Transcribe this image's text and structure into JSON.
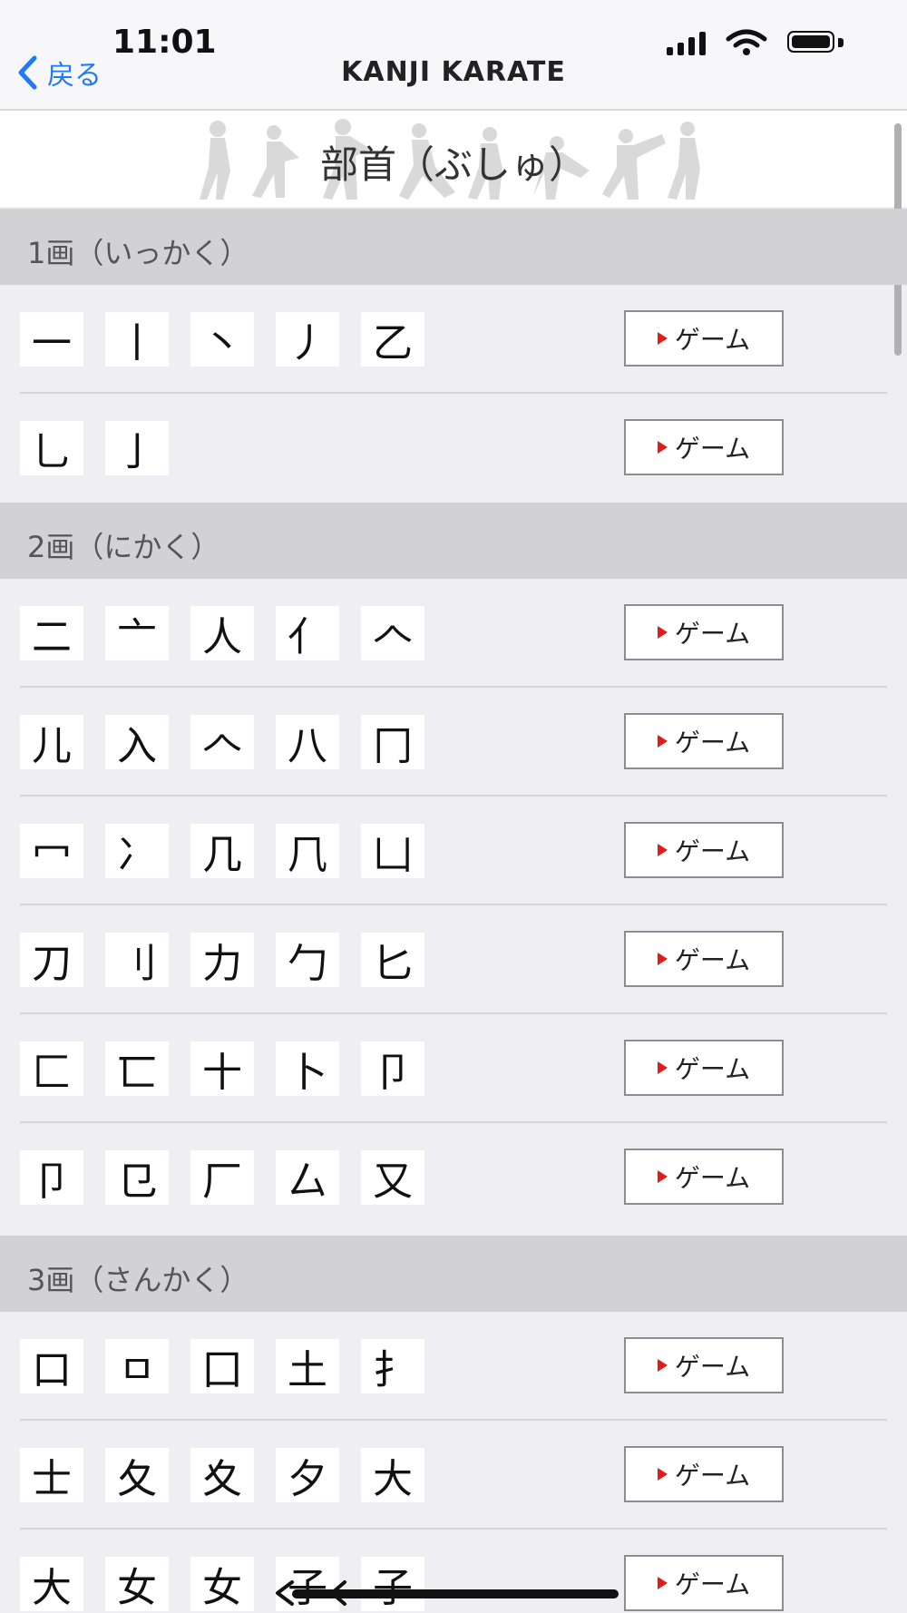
{
  "status_bar": {
    "time": "11:01",
    "icons": [
      "cellular-signal-icon",
      "wifi-icon",
      "battery-icon"
    ]
  },
  "nav": {
    "back_label": "戻る",
    "title": "KANJI KARATE"
  },
  "banner": {
    "title": "部首（ぶしゅ）"
  },
  "colors": {
    "accent": "#1f7af5",
    "play_icon": "#e21b1b",
    "section_header_bg": "#d2d2d5",
    "page_bg": "#efeef3"
  },
  "sections": [
    {
      "header": "1画（いっかく）",
      "rows": [
        {
          "chars": [
            "一",
            "丨",
            "丶",
            "丿",
            "乙"
          ],
          "button": "ゲーム"
        },
        {
          "chars": [
            "乚",
            "亅"
          ],
          "button": "ゲーム"
        }
      ]
    },
    {
      "header": "2画（にかく）",
      "rows": [
        {
          "chars": [
            "二",
            "亠",
            "人",
            "亻",
            "𠆢"
          ],
          "button": "ゲーム"
        },
        {
          "chars": [
            "儿",
            "入",
            "𠆢",
            "八",
            "冂"
          ],
          "button": "ゲーム"
        },
        {
          "chars": [
            "冖",
            "冫",
            "几",
            "⺇",
            "凵"
          ],
          "button": "ゲーム"
        },
        {
          "chars": [
            "刀",
            "刂",
            "力",
            "勹",
            "匕"
          ],
          "button": "ゲーム"
        },
        {
          "chars": [
            "匚",
            "匸",
            "十",
            "卜",
            "卩"
          ],
          "button": "ゲーム"
        },
        {
          "chars": [
            "卩",
            "㔾",
            "厂",
            "厶",
            "又"
          ],
          "button": "ゲーム"
        }
      ]
    },
    {
      "header": "3画（さんかく）",
      "rows": [
        {
          "chars": [
            "口",
            "ㅁ",
            "囗",
            "土",
            "扌"
          ],
          "button": "ゲーム"
        },
        {
          "chars": [
            "士",
            "夂",
            "夊",
            "夕",
            "大"
          ],
          "button": "ゲーム"
        },
        {
          "chars": [
            "大",
            "女",
            "女",
            "子",
            "子"
          ],
          "button": "ゲーム"
        }
      ]
    }
  ]
}
